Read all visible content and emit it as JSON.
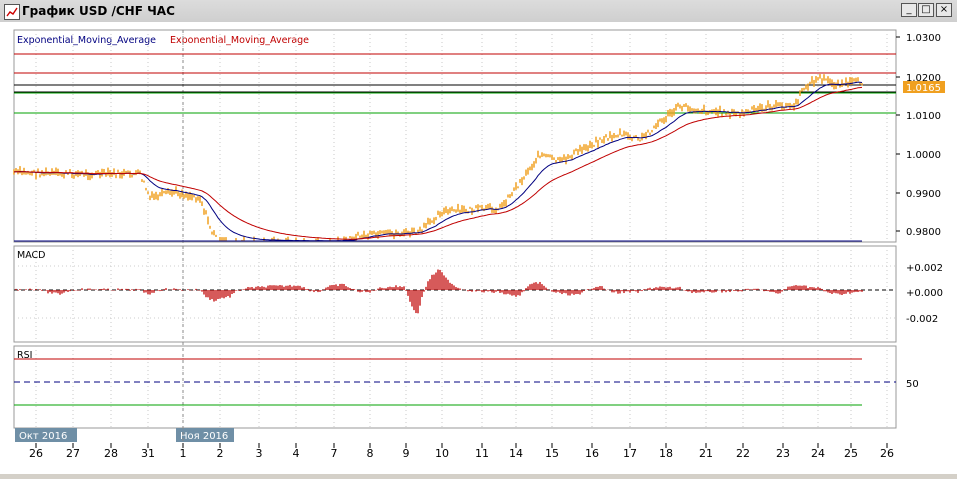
{
  "window": {
    "title": "График USD /CHF ЧАС",
    "minimize": "_",
    "maximize": "□",
    "close": "×"
  },
  "main_panel": {
    "legend": {
      "ema1": "Exponential_Moving_Average",
      "ema2": "Exponential_Moving_Average"
    },
    "price_labels": [
      "1.0300",
      "1.0200",
      "1.0100",
      "1.0000",
      "0.9900",
      "0.9800"
    ],
    "current_price": "1.0165",
    "colors": {
      "bars": "#f0a020",
      "ema_fast": "#000080",
      "ema_slow": "#c00000",
      "resistance": "#c00000",
      "support": "#00a000"
    }
  },
  "macd_panel": {
    "label": "MACD",
    "levels": [
      "+0.002",
      "+0.000",
      "-0.002"
    ]
  },
  "rsi_panel": {
    "label": "RSI",
    "level": "50"
  },
  "time_axis": {
    "labels": [
      "26",
      "27",
      "28",
      "31",
      "1",
      "2",
      "3",
      "4",
      "7",
      "8",
      "9",
      "10",
      "11",
      "14",
      "15",
      "16",
      "17",
      "18",
      "21",
      "22",
      "23",
      "24",
      "25",
      "26"
    ],
    "month_labels": [
      "Окт 2016",
      "Ноя 2016"
    ]
  }
}
